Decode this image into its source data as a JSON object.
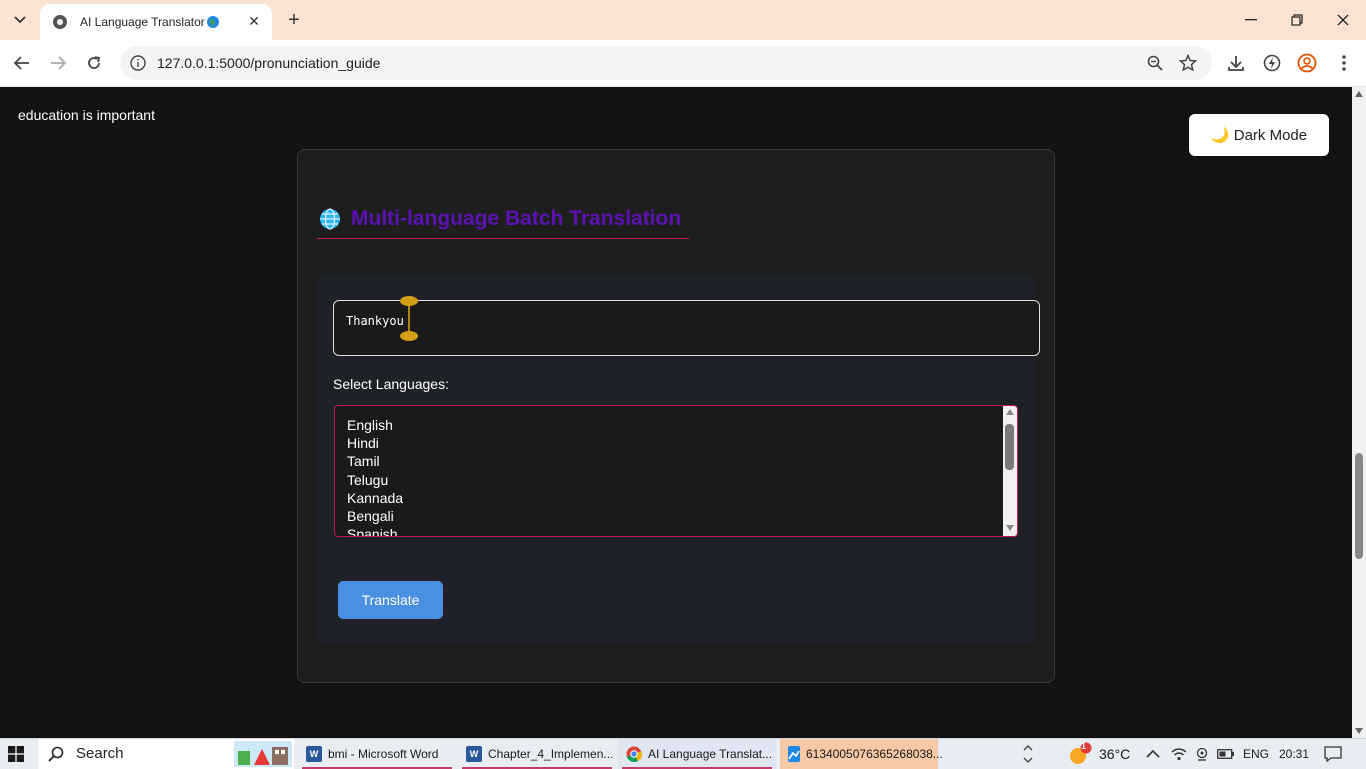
{
  "browser": {
    "tab_title": "AI Language Translator",
    "url": "127.0.0.1:5000/pronunciation_guide"
  },
  "page": {
    "top_text": "education is important",
    "dark_mode_label": "🌙 Dark Mode",
    "heading": "Multi-language Batch Translation",
    "input_value": "Thankyou",
    "select_label": "Select Languages:",
    "languages": [
      "English",
      "Hindi",
      "Tamil",
      "Telugu",
      "Kannada",
      "Bengali",
      "Spanish"
    ],
    "translate_label": "Translate"
  },
  "taskbar": {
    "search_label": "Search",
    "items": [
      {
        "label": "bmi - Microsoft Word"
      },
      {
        "label": "Chapter_4_Implemen..."
      },
      {
        "label": "AI Language Translat..."
      },
      {
        "label": "6134005076365268038..."
      }
    ],
    "weather_badge": "1",
    "temperature": "36°C",
    "language": "ENG",
    "time": "20:31"
  },
  "colors": {
    "heading": "#5b12b3",
    "accent_border": "#c2185b",
    "button": "#4a90e2",
    "card_bg": "#1e1e1e"
  }
}
